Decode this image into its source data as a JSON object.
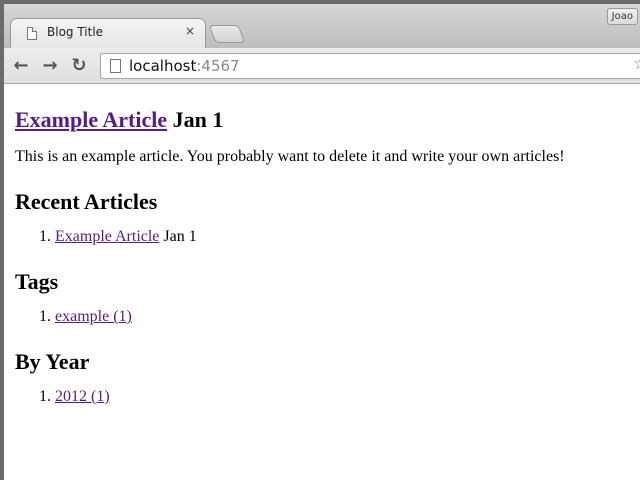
{
  "browser": {
    "profile_name": "Joao",
    "tab": {
      "title": "Blog Title",
      "close_glyph": "×"
    },
    "nav": {
      "back": "←",
      "forward": "→",
      "reload": "↻"
    },
    "address": {
      "host": "localhost",
      "port": ":4567"
    },
    "star": "☆"
  },
  "article": {
    "link_text": "Example Article",
    "date": "Jan 1",
    "body": "This is an example article. You probably want to delete it and write your own articles!"
  },
  "recent": {
    "heading": "Recent Articles",
    "items": [
      {
        "title": "Example Article",
        "date": "Jan 1"
      }
    ]
  },
  "tags": {
    "heading": "Tags",
    "items": [
      {
        "label": "example (1)"
      }
    ]
  },
  "by_year": {
    "heading": "By Year",
    "items": [
      {
        "label": "2012 (1)"
      }
    ]
  }
}
